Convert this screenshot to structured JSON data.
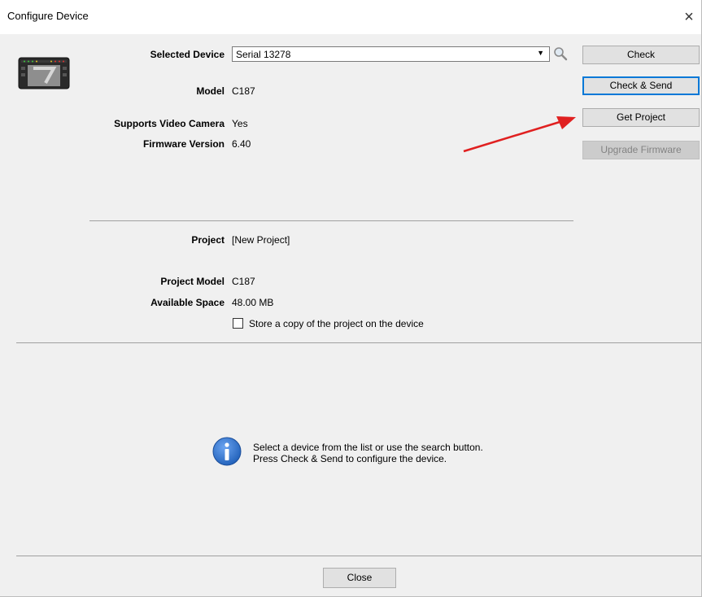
{
  "window": {
    "title": "Configure Device",
    "close_glyph": "×"
  },
  "device": {
    "selected_label": "Selected Device",
    "selected_value": "Serial 13278",
    "model_label": "Model",
    "model_value": "C187",
    "video_label": "Supports Video Camera",
    "video_value": "Yes",
    "firmware_label": "Firmware Version",
    "firmware_value": "6.40"
  },
  "buttons": {
    "check": "Check",
    "check_send": "Check & Send",
    "get_project": "Get Project",
    "upgrade_firmware": "Upgrade Firmware",
    "close": "Close"
  },
  "project": {
    "project_label": "Project",
    "project_value": "[New Project]",
    "model_label": "Project Model",
    "model_value": "C187",
    "space_label": "Available Space",
    "space_value": "48.00 MB",
    "store_copy_label": "Store a copy of the project on the device",
    "store_copy_checked": false
  },
  "info": {
    "line1": "Select a device from the list or use the search button.",
    "line2": "Press Check & Send to configure the device."
  },
  "colors": {
    "accent": "#0078d7",
    "annotation_arrow": "#e02020",
    "info_blue": "#1f5fb8"
  }
}
